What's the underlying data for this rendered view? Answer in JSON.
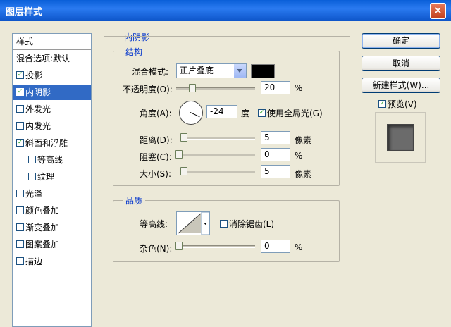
{
  "window": {
    "title": "图层样式",
    "close_glyph": "×"
  },
  "sidebar": {
    "header": "样式",
    "items": [
      {
        "label": "混合选项:默认",
        "checkbox": false,
        "checked": false,
        "selected": false,
        "indent": false
      },
      {
        "label": "投影",
        "checkbox": true,
        "checked": true,
        "selected": false,
        "indent": false
      },
      {
        "label": "内阴影",
        "checkbox": true,
        "checked": true,
        "selected": true,
        "indent": false
      },
      {
        "label": "外发光",
        "checkbox": true,
        "checked": false,
        "selected": false,
        "indent": false
      },
      {
        "label": "内发光",
        "checkbox": true,
        "checked": false,
        "selected": false,
        "indent": false
      },
      {
        "label": "斜面和浮雕",
        "checkbox": true,
        "checked": true,
        "selected": false,
        "indent": false
      },
      {
        "label": "等高线",
        "checkbox": true,
        "checked": false,
        "selected": false,
        "indent": true
      },
      {
        "label": "纹理",
        "checkbox": true,
        "checked": false,
        "selected": false,
        "indent": true
      },
      {
        "label": "光泽",
        "checkbox": true,
        "checked": false,
        "selected": false,
        "indent": false
      },
      {
        "label": "颜色叠加",
        "checkbox": true,
        "checked": false,
        "selected": false,
        "indent": false
      },
      {
        "label": "渐变叠加",
        "checkbox": true,
        "checked": false,
        "selected": false,
        "indent": false
      },
      {
        "label": "图案叠加",
        "checkbox": true,
        "checked": false,
        "selected": false,
        "indent": false
      },
      {
        "label": "描边",
        "checkbox": true,
        "checked": false,
        "selected": false,
        "indent": false
      }
    ]
  },
  "panel": {
    "section_title": "内阴影",
    "structure": {
      "title": "结构",
      "blend_mode_label": "混合模式:",
      "blend_mode_value": "正片叠底",
      "blend_color": "#000000",
      "opacity_label": "不透明度(O):",
      "opacity_value": "20",
      "opacity_unit": "%",
      "opacity_level": 0.2,
      "angle_label": "角度(A):",
      "angle_value": "-24",
      "angle_unit": "度",
      "global_light_label": "使用全局光(G)",
      "global_light_checked": true,
      "distance_label": "距离(D):",
      "distance_value": "5",
      "distance_unit": "像素",
      "choke_label": "阻塞(C):",
      "choke_value": "0",
      "choke_unit": "%",
      "size_label": "大小(S):",
      "size_value": "5",
      "size_unit": "像素"
    },
    "quality": {
      "title": "品质",
      "contour_label": "等高线:",
      "anti_alias_label": "消除锯齿(L)",
      "anti_alias_checked": false,
      "noise_label": "杂色(N):",
      "noise_value": "0",
      "noise_unit": "%"
    }
  },
  "buttons": {
    "ok": "确定",
    "cancel": "取消",
    "new_style": "新建样式(W)...",
    "preview_label": "预览(V)",
    "preview_checked": true
  },
  "colors": {
    "selection": "#316ac5",
    "title_bar": "#0a5fd8",
    "section_title": "#0033cc"
  }
}
